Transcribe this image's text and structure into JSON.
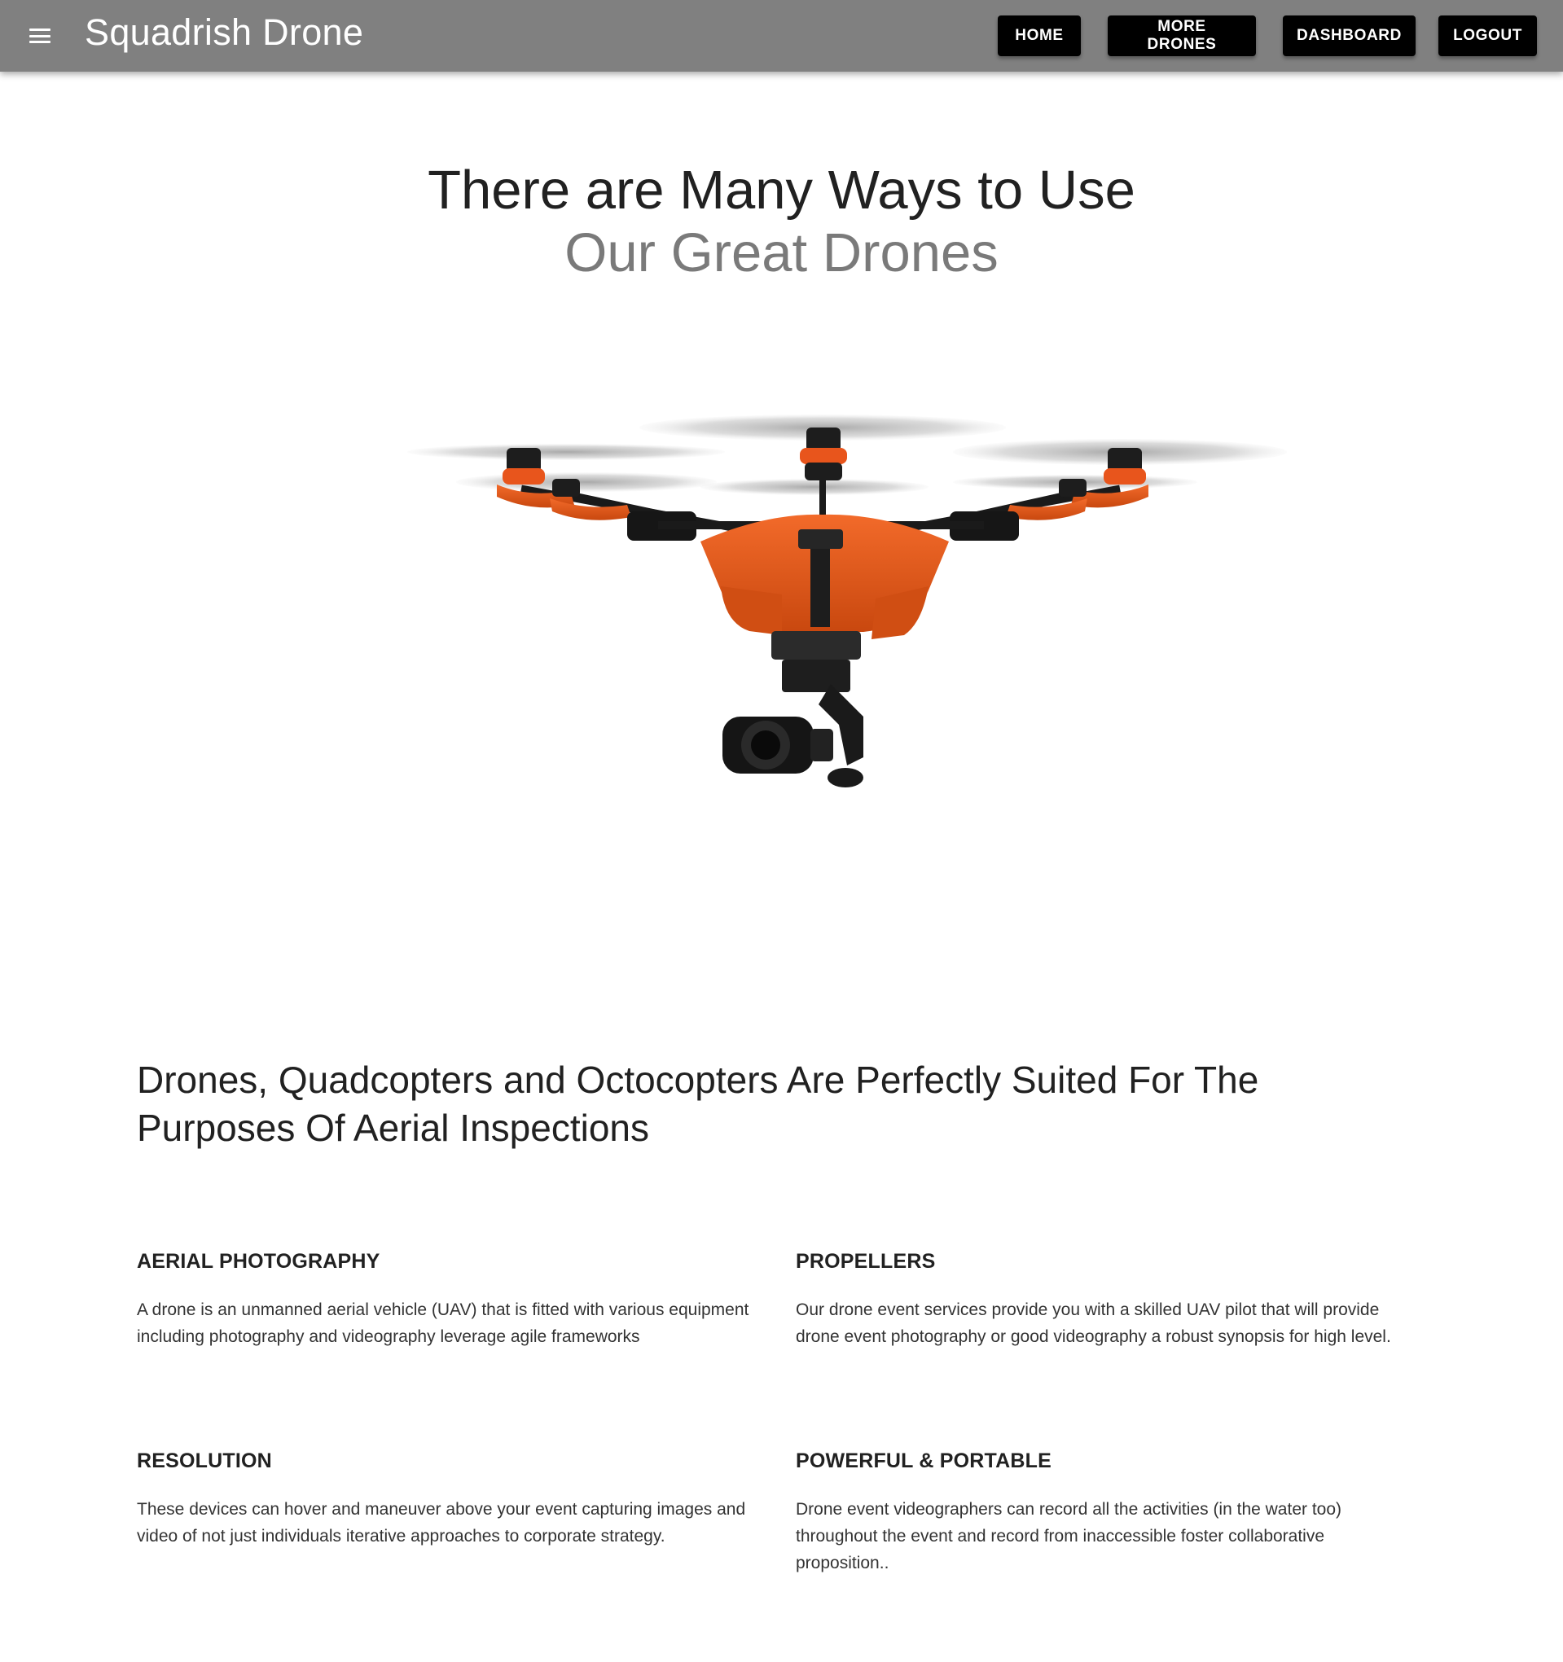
{
  "header": {
    "brand": "Squadrish Drone",
    "menu_icon": "hamburger-menu-icon",
    "background_color": "#808080",
    "nav": [
      {
        "label": "HOME"
      },
      {
        "label": "MORE DRONES"
      },
      {
        "label": "DASHBOARD"
      },
      {
        "label": "LOGOUT"
      }
    ]
  },
  "hero": {
    "title_line1": "There are Many Ways to Use",
    "title_line2": "Our Great Drones"
  },
  "section": {
    "title": "Drones, Quadcopters and Octocopters Are Perfectly Suited For The Purposes Of Aerial Inspections",
    "features": [
      {
        "heading": "AERIAL PHOTOGRAPHY",
        "text": "A drone is an unmanned aerial vehicle (UAV) that is fitted with various equipment including photography and videography leverage agile frameworks"
      },
      {
        "heading": "PROPELLERS",
        "text": "Our drone event services provide you with a skilled UAV pilot that will provide drone event photography or good videography a robust synopsis for high level."
      },
      {
        "heading": "RESOLUTION",
        "text": "These devices can hover and maneuver above your event capturing images and video of not just individuals iterative approaches to corporate strategy."
      },
      {
        "heading": "POWERFUL & PORTABLE",
        "text": "Drone event videographers can record all the activities (in the water too) throughout the event and record from inaccessible foster collaborative proposition.."
      }
    ]
  },
  "colors": {
    "accent_orange": "#e8551c",
    "button_black": "#000000"
  }
}
